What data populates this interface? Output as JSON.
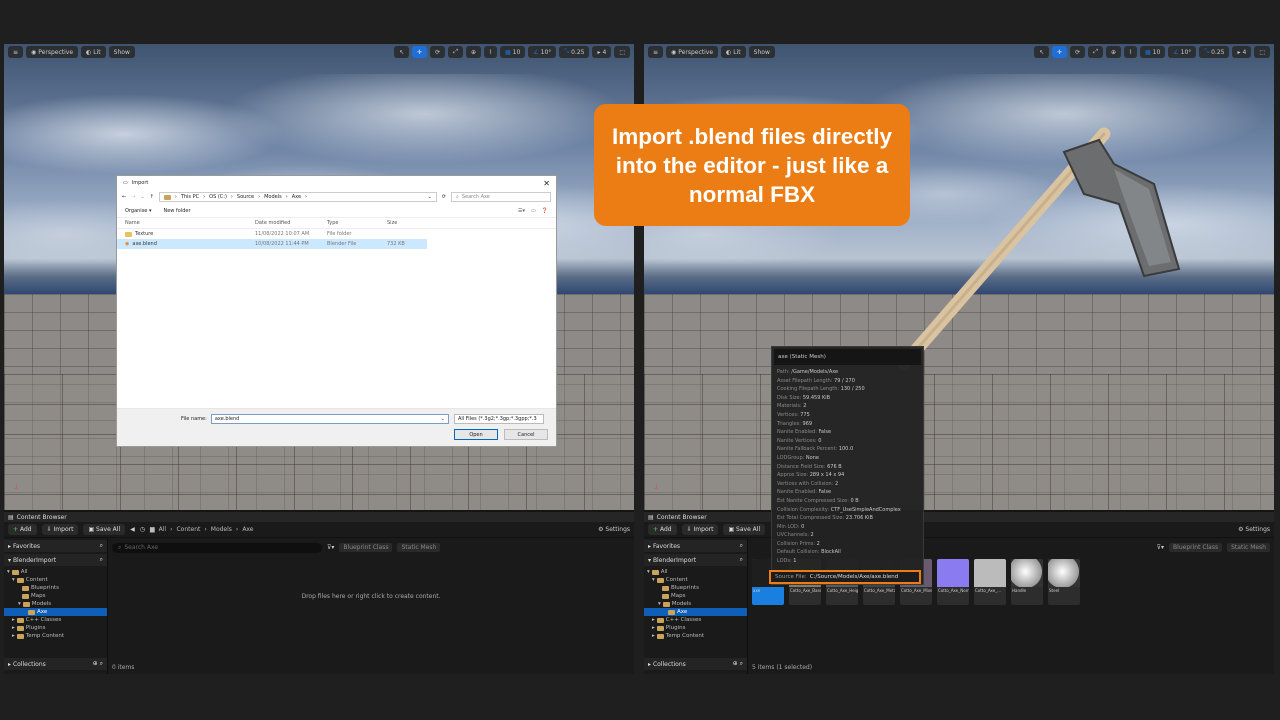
{
  "callout": {
    "text": "Import .blend files directly into the editor - just like a normal FBX"
  },
  "viewport": {
    "perspective": "Perspective",
    "lit": "Lit",
    "show": "Show",
    "grid": "10",
    "angle": "10°",
    "scale": "0.25",
    "cams": "4"
  },
  "dialog": {
    "title": "Import",
    "path": [
      "This PC",
      "OS (C:)",
      "Source",
      "Models",
      "Axe"
    ],
    "search_placeholder": "Search Axe",
    "organise": "Organise ▾",
    "new_folder": "New folder",
    "columns": [
      "Name",
      "Date modified",
      "Type",
      "Size"
    ],
    "files": [
      {
        "name": "Texture",
        "date": "11/08/2022 10:07 AM",
        "type": "File folder",
        "size": ""
      },
      {
        "name": "axe.blend",
        "date": "10/08/2022 11:44 PM",
        "type": "Blender File",
        "size": "732 KB"
      }
    ],
    "file_name_label": "File name:",
    "file_name_value": "axe.blend",
    "file_type": "All Files (*.3g2;*.3gp;*.3gpp;*.3",
    "open": "Open",
    "cancel": "Cancel"
  },
  "content_browser": {
    "tab": "Content Browser",
    "add": "Add",
    "import": "Import",
    "save_all": "Save All",
    "breadcrumb": [
      "All",
      "Content",
      "Models",
      "Axe"
    ],
    "settings": "Settings",
    "search_placeholder": "Search Axe",
    "filter1": "Blueprint Class",
    "filter2": "Static Mesh",
    "favorites": "Favorites",
    "project": "BlenderImport",
    "collections": "Collections",
    "tree": [
      "All",
      "Content",
      "Blueprints",
      "Maps",
      "Models",
      "Axe",
      "C++ Classes",
      "Plugins",
      "Temp Content"
    ],
    "drop_hint": "Drop files here or right click to create content.",
    "count_left": "0 items",
    "count_right": "5 items (1 selected)",
    "thumbs": [
      "axe",
      "Cotto_Axe_Base_...",
      "Cotto_Axe_Height",
      "Cotto_Axe_Metallic",
      "Cotto_Axe_Mixed_...",
      "Cotto_Axe_Normal...",
      "Cotto_Axe_...",
      "Handle",
      "Steel"
    ]
  },
  "tooltip": {
    "title": "axe (Static Mesh)",
    "lines": [
      [
        "Path:",
        "/Game/Models/Axe"
      ],
      [
        "Asset Filepath Length:",
        "79 / 270"
      ],
      [
        "Cooking Filepath Length:",
        "130 / 250"
      ],
      [
        "Disk Size:",
        "59.459 KiB"
      ],
      [
        "Materials:",
        "2"
      ],
      [
        "Vertices:",
        "775"
      ],
      [
        "Triangles:",
        "969"
      ],
      [
        "Nanite Enabled:",
        "False"
      ],
      [
        "Nanite Vertices:",
        "0"
      ],
      [
        "Nanite Fallback Percent:",
        "100.0"
      ],
      [
        "LODGroup:",
        "None"
      ],
      [
        "Distance Field Size:",
        "676 B"
      ],
      [
        "Approx Size:",
        "289 x 14 x 94"
      ],
      [
        "Vertices with Collision:",
        "2"
      ],
      [
        "Nanite Enabled:",
        "False"
      ],
      [
        "Est Nanite Compressed Size:",
        "0 B"
      ],
      [
        "Collision Complexity:",
        "CTF_UseSimpleAndComplex"
      ],
      [
        "Est Total Compressed Size:",
        "23.706 KiB"
      ],
      [
        "Min LOD:",
        "0"
      ],
      [
        "UVChannels:",
        "2"
      ],
      [
        "Collision Prims:",
        "2"
      ],
      [
        "Default Collision:",
        "BlockAll"
      ],
      [
        "LODs:",
        "1"
      ]
    ],
    "source_label": "Source File:",
    "source_value": "C:/Source/Models/Axe/axe.blend"
  }
}
